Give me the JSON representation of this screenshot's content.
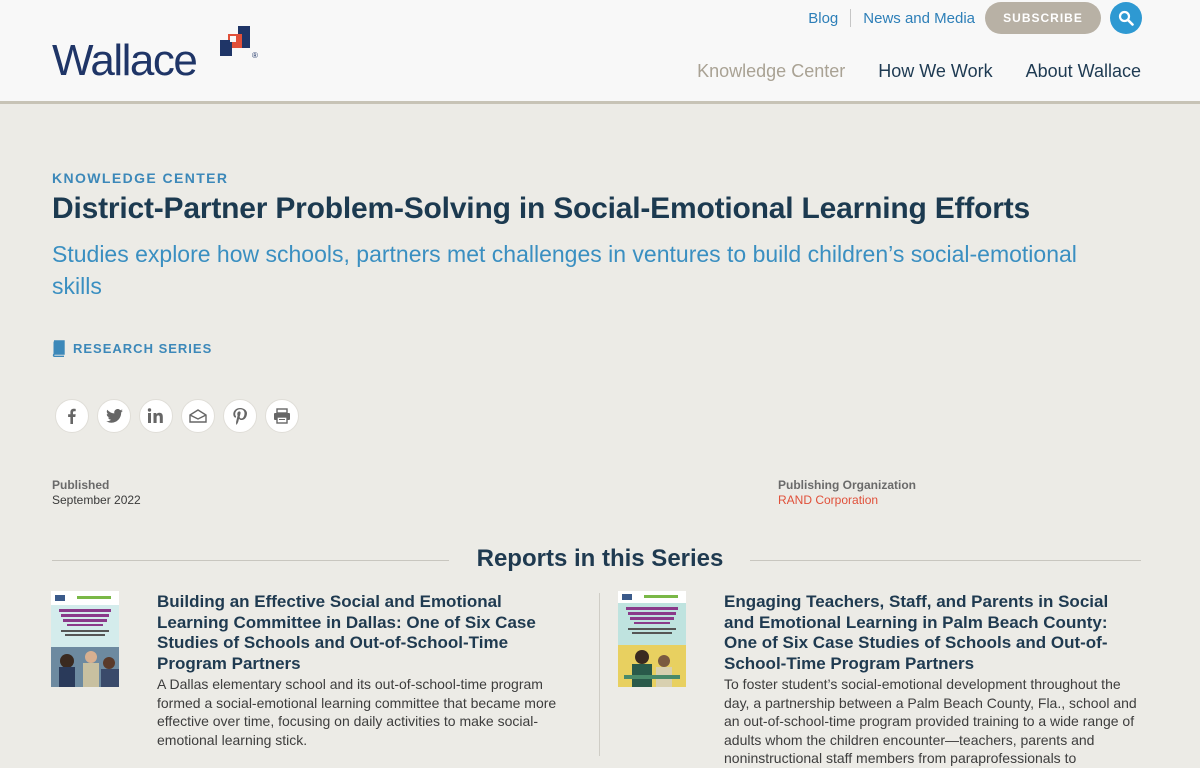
{
  "header": {
    "logo_text": "Wallace",
    "utility_links": [
      "Blog",
      "News and Media"
    ],
    "subscribe_label": "SUBSCRIBE",
    "nav": [
      "Knowledge Center",
      "How We Work",
      "About Wallace"
    ]
  },
  "hero": {
    "kicker": "KNOWLEDGE CENTER",
    "title": "District-Partner Problem-Solving in Social-Emotional Learning Efforts",
    "subtitle": "Studies explore how schools, partners met challenges in ventures to build children’s social-emotional skills",
    "series_label": "RESEARCH SERIES"
  },
  "share_icons": [
    "facebook-icon",
    "twitter-icon",
    "linkedin-icon",
    "email-icon",
    "pinterest-icon",
    "print-icon"
  ],
  "meta": {
    "published_label": "Published",
    "published_value": "September 2022",
    "org_label": "Publishing Organization",
    "org_value": "RAND Corporation"
  },
  "reports": {
    "heading": "Reports in this Series",
    "items": [
      {
        "title": "Building an Effective Social and Emotional Learning Committee in Dallas: One of Six Case Studies of Schools and Out-of-School-Time Program Partners",
        "description": "A Dallas elementary school and its out-of-school-time program formed a social-emotional learning committee that became more effective over time, focusing on daily activities to make social-emotional learning stick."
      },
      {
        "title": "Engaging Teachers, Staff, and Parents in Social and Emotional Learning in Palm Beach County: One of Six Case Studies of Schools and Out-of-School-Time Program Partners",
        "description": "To foster student’s social-emotional development throughout the day, a partnership between a Palm Beach County, Fla., school and an out-of-school-time program provided training to a wide range of adults whom the children encounter—teachers, parents and noninstructional staff members from paraprofessionals to"
      }
    ]
  },
  "colors": {
    "navy": "#1f3567",
    "accent_blue": "#3a8fc1",
    "brand_red": "#e0503a",
    "subscribe_bg": "#b8b1a5",
    "page_bg": "#ecebe6"
  }
}
